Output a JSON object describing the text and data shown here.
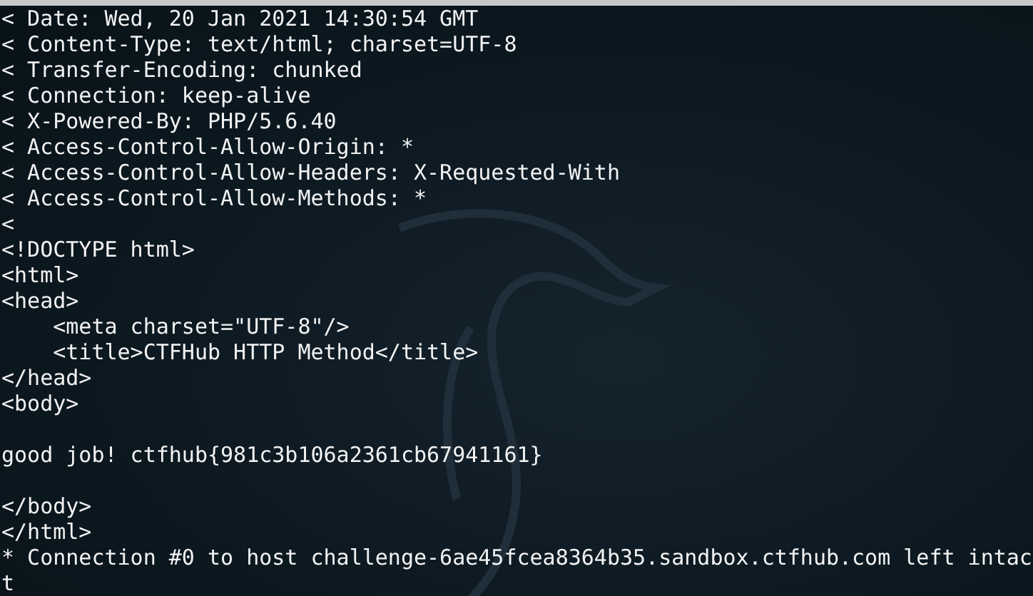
{
  "terminal": {
    "lines": [
      {
        "kind": "text",
        "text": "< Date: Wed, 20 Jan 2021 14:30:54 GMT"
      },
      {
        "kind": "text",
        "text": "< Content-Type: text/html; charset=UTF-8"
      },
      {
        "kind": "text",
        "text": "< Transfer-Encoding: chunked"
      },
      {
        "kind": "text",
        "text": "< Connection: keep-alive"
      },
      {
        "kind": "text",
        "text": "< X-Powered-By: PHP/5.6.40"
      },
      {
        "kind": "text",
        "text": "< Access-Control-Allow-Origin: *"
      },
      {
        "kind": "text",
        "text": "< Access-Control-Allow-Headers: X-Requested-With"
      },
      {
        "kind": "text",
        "text": "< Access-Control-Allow-Methods: *"
      },
      {
        "kind": "text",
        "text": "<"
      },
      {
        "kind": "text",
        "text": "<!DOCTYPE html>"
      },
      {
        "kind": "text",
        "text": "<html>"
      },
      {
        "kind": "text",
        "text": "<head>"
      },
      {
        "kind": "text",
        "text": "    <meta charset=\"UTF-8\"/>"
      },
      {
        "kind": "text",
        "text": "    <title>CTFHub HTTP Method</title>"
      },
      {
        "kind": "text",
        "text": "</head>"
      },
      {
        "kind": "text",
        "text": "<body>"
      },
      {
        "kind": "blank"
      },
      {
        "kind": "text",
        "text": "good job! ctfhub{981c3b106a2361cb67941161}"
      },
      {
        "kind": "blank"
      },
      {
        "kind": "text",
        "text": "</body>"
      },
      {
        "kind": "text",
        "text": "</html>"
      },
      {
        "kind": "text",
        "text": "* Connection #0 to host challenge-6ae45fcea8364b35.sandbox.ctfhub.com left intac"
      },
      {
        "kind": "text",
        "text": "t"
      }
    ]
  }
}
